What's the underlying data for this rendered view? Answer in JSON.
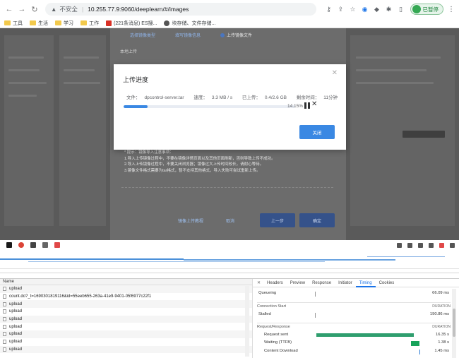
{
  "browser": {
    "insecure_label": "不安全",
    "url": "10.255.77.9:9060/deeplearn/#/images",
    "profile_label": "已暂停",
    "bookmarks": [
      "工具",
      "生活",
      "学习",
      "工作",
      "(221条消息) ES搜...",
      "块存储、文件存储..."
    ]
  },
  "remote_app": {
    "steps": [
      "选择镜像类型",
      "填写镜像信息",
      "上传镜像文件"
    ],
    "tab_chip": "本地上传",
    "notes": [
      "* 提示：镜像导入注意事项：",
      "1.导入上传镜像过程中，不要在镜像详情页面以及其他页面刷新，否则导致上传不成功。",
      "2.导入上传镜像过程中，不要关闭浏览器；镜像过大上传时间较长，请耐心等待。",
      "3.镜像文件格式需要为tar格式，暂不支持其他格式，导入失败可尝试重新上传。"
    ],
    "footer_links": [
      "镜像上传教程",
      "取消"
    ],
    "footer_buttons": [
      "上一步",
      "确定"
    ]
  },
  "modal": {
    "title": "上传进度",
    "file_label": "文件：",
    "file_name": "dpcontrol-server.tar",
    "speed_label": "速度：",
    "speed": "3.3 MB / s",
    "uploaded_label": "已上传：",
    "uploaded": "0.4/2.6 GB",
    "remaining_label": "剩余时间：",
    "remaining": "11分钟",
    "progress_percent": 14.15,
    "progress_text": "14.15%",
    "ok_label": "关闭",
    "accent": "#3a88e3"
  },
  "devtools": {
    "list_header": "Name",
    "requests": [
      "upload",
      "count.do?_t=1690301819116&id=55eeb655-263a-41e9-9401-05f6977c22f1",
      "upload",
      "upload",
      "upload",
      "upload",
      "upload",
      "upload",
      "upload"
    ],
    "tabs": [
      "Headers",
      "Preview",
      "Response",
      "Initiator",
      "Timing",
      "Cookies"
    ],
    "active_tab": "Timing",
    "timing": {
      "queueing_label": "Queueing",
      "queueing": "66.09 ms",
      "connection_section": "Connection Start",
      "duration_label": "DURATION",
      "stalled_label": "Stalled",
      "stalled": "190.86 ms",
      "request_section": "Request/Response",
      "request_sent_label": "Request sent",
      "request_sent": "16.35 s",
      "waiting_label": "Waiting (TTFB)",
      "waiting": "1.38 s",
      "download_label": "Content Download",
      "download": "1.45 ms"
    }
  }
}
